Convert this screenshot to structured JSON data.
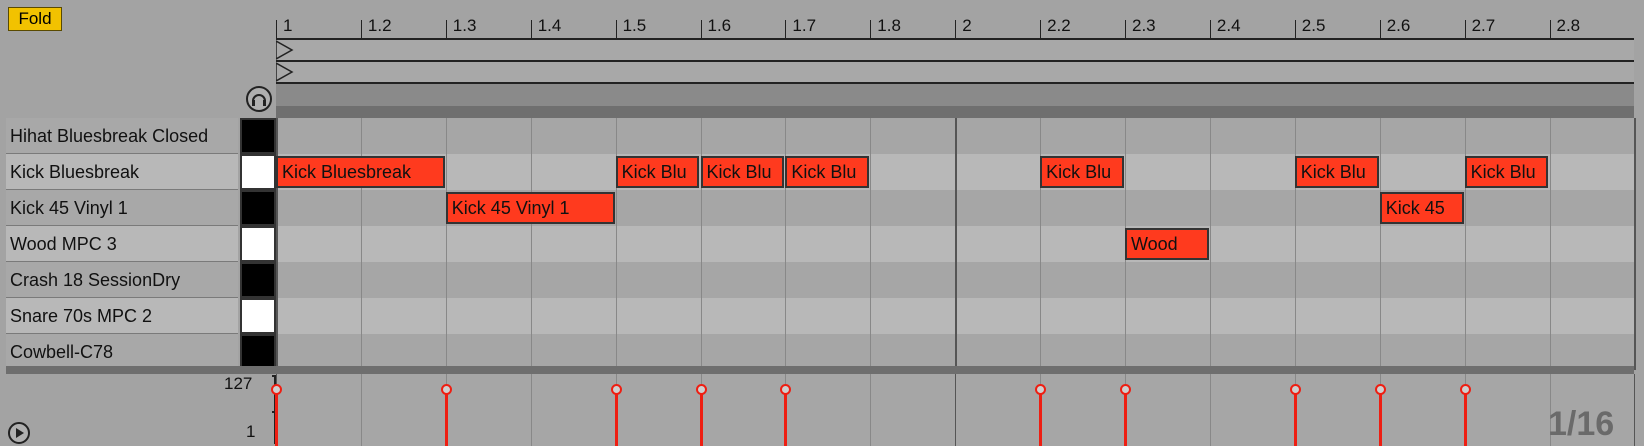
{
  "toolbar": {
    "fold_label": "Fold"
  },
  "ruler": {
    "labels": [
      "1",
      "1.2",
      "1.3",
      "1.4",
      "1.5",
      "1.6",
      "1.7",
      "1.8",
      "2",
      "2.2",
      "2.3",
      "2.4",
      "2.5",
      "2.6",
      "2.7",
      "2.8"
    ]
  },
  "tracks": [
    {
      "name": "Hihat Bluesbreak Closed",
      "key": "black"
    },
    {
      "name": "Kick Bluesbreak",
      "key": "white"
    },
    {
      "name": "Kick 45 Vinyl 1",
      "key": "black"
    },
    {
      "name": "Wood MPC 3",
      "key": "white"
    },
    {
      "name": "Crash 18 SessionDry",
      "key": "black"
    },
    {
      "name": "Snare 70s MPC 2",
      "key": "white"
    },
    {
      "name": "Cowbell-C78",
      "key": "black"
    }
  ],
  "notes": [
    {
      "track": 1,
      "start_step": 0,
      "length_steps": 2,
      "label": "Kick Bluesbreak"
    },
    {
      "track": 1,
      "start_step": 4,
      "length_steps": 1,
      "label": "Kick Blu"
    },
    {
      "track": 1,
      "start_step": 5,
      "length_steps": 1,
      "label": "Kick Blu"
    },
    {
      "track": 1,
      "start_step": 6,
      "length_steps": 1,
      "label": "Kick Blu"
    },
    {
      "track": 1,
      "start_step": 9,
      "length_steps": 1,
      "label": "Kick Blu"
    },
    {
      "track": 1,
      "start_step": 12,
      "length_steps": 1,
      "label": "Kick Blu"
    },
    {
      "track": 1,
      "start_step": 14,
      "length_steps": 1,
      "label": "Kick Blu"
    },
    {
      "track": 2,
      "start_step": 2,
      "length_steps": 2,
      "label": "Kick 45 Vinyl 1"
    },
    {
      "track": 2,
      "start_step": 13,
      "length_steps": 1,
      "label": "Kick 45"
    },
    {
      "track": 3,
      "start_step": 10,
      "length_steps": 1,
      "label": "Wood"
    }
  ],
  "velocity": {
    "max_label": "127",
    "min_label": "1",
    "events": [
      {
        "step": 0,
        "value": 127
      },
      {
        "step": 2,
        "value": 127
      },
      {
        "step": 4,
        "value": 127
      },
      {
        "step": 5,
        "value": 127
      },
      {
        "step": 6,
        "value": 127
      },
      {
        "step": 9,
        "value": 127
      },
      {
        "step": 10,
        "value": 127
      },
      {
        "step": 12,
        "value": 127
      },
      {
        "step": 13,
        "value": 127
      },
      {
        "step": 14,
        "value": 127
      }
    ]
  },
  "grid_resolution": "1/16",
  "colors": {
    "note": "#ff3a1e",
    "fold": "#f2c200",
    "velocity": "#ee1e12"
  }
}
